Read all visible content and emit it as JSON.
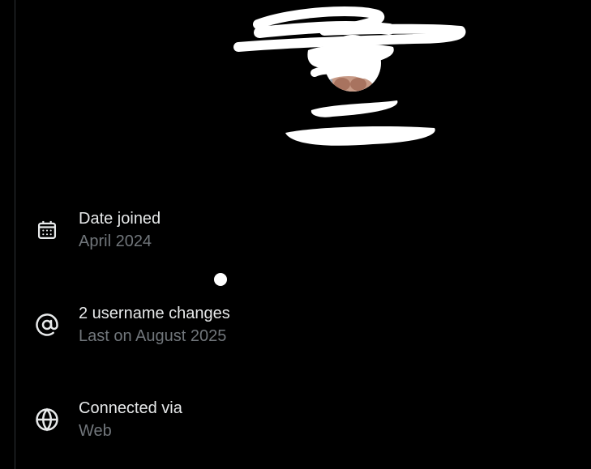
{
  "colors": {
    "background": "#000000",
    "primary_text": "#e7e9ea",
    "secondary_text": "#71767b",
    "border": "#2f3336"
  },
  "about": {
    "items": [
      {
        "icon": "calendar-icon",
        "title": "Date joined",
        "subtitle": "April 2024"
      },
      {
        "icon": "at-sign-icon",
        "title": "2 username changes",
        "subtitle": "Last on August 2025"
      },
      {
        "icon": "globe-icon",
        "title": "Connected via",
        "subtitle": "Web"
      }
    ]
  }
}
